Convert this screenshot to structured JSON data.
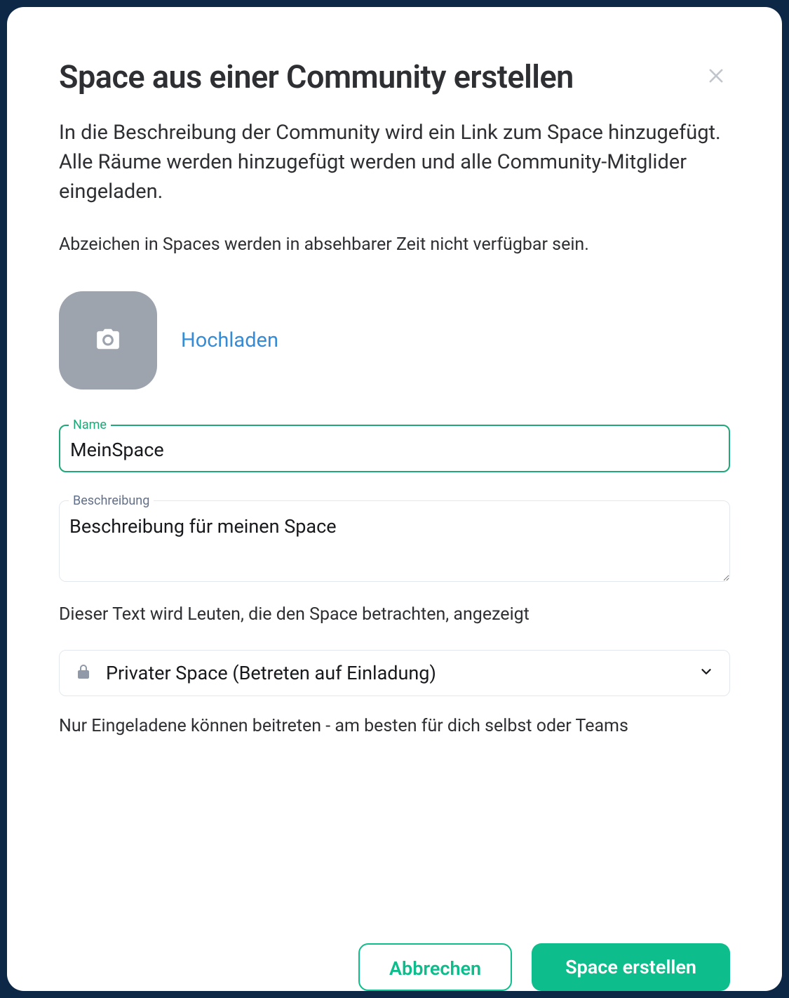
{
  "dialog": {
    "title": "Space aus einer Community erstellen",
    "subtitle": "In die Beschreibung der Community wird ein Link zum Space hinzugefügt. Alle Räume werden hinzugefügt werden und alle Community-Mitglider eingeladen.",
    "notice": "Abzeichen in Spaces werden in absehbarer Zeit nicht verfügbar sein.",
    "upload_label": "Hochladen",
    "name_label": "Name",
    "name_value": "MeinSpace",
    "desc_label": "Beschreibung",
    "desc_value": "Beschreibung für meinen Space",
    "desc_helper": "Dieser Text wird Leuten, die den Space betrachten, angezeigt",
    "privacy_selected": "Privater Space (Betreten auf Einladung)",
    "privacy_helper": "Nur Eingeladene können beitreten - am besten für dich selbst oder Teams",
    "cancel_label": "Abbrechen",
    "create_label": "Space erstellen"
  }
}
